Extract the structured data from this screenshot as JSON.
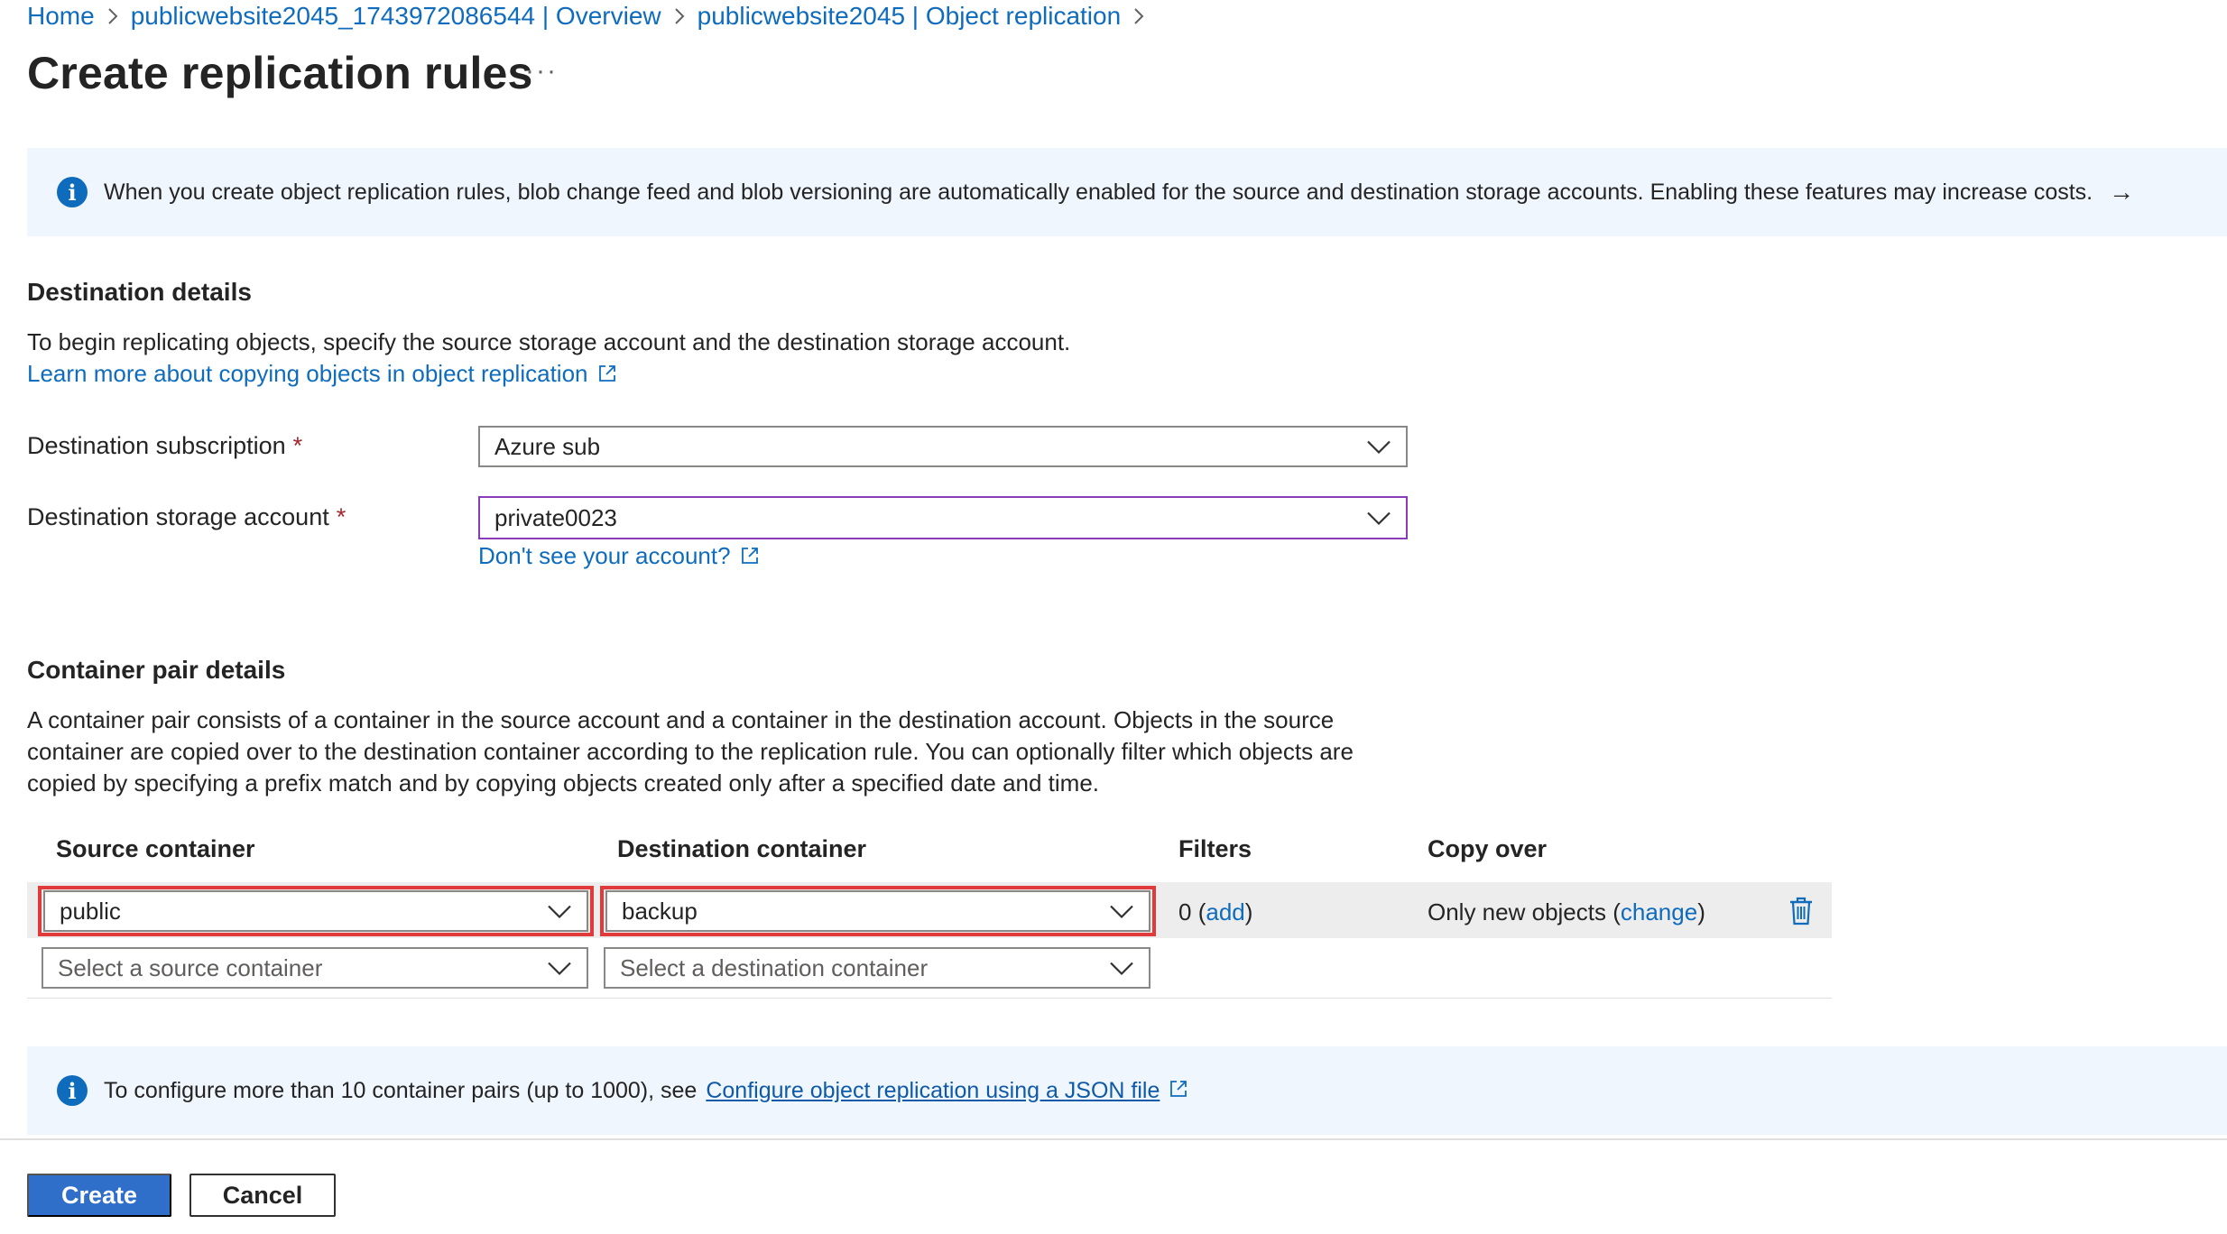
{
  "breadcrumb": {
    "items": [
      {
        "label": "Home"
      },
      {
        "label": "publicwebsite2045_1743972086544 | Overview"
      },
      {
        "label": "publicwebsite2045 | Object replication"
      }
    ]
  },
  "page": {
    "title": "Create replication rules",
    "more_label": "···"
  },
  "banner_top": {
    "icon": "info-icon",
    "text": "When you create object replication rules, blob change feed and blob versioning are automatically enabled for the source and destination storage accounts. Enabling these features may increase costs.",
    "arrow": "→"
  },
  "destination": {
    "heading": "Destination details",
    "description": "To begin replicating objects, specify the source storage account and the destination storage account.",
    "learn_more": "Learn more about copying objects in object replication",
    "subscription_label": "Destination subscription",
    "subscription_value": "Azure sub",
    "storage_label": "Destination storage account",
    "storage_value": "private0023",
    "required_mark": "*",
    "dont_see_link": "Don't see your account?"
  },
  "container_pairs": {
    "heading": "Container pair details",
    "description_lines": [
      "A container pair consists of a container in the source account and a container in the destination account. Objects in the source",
      "container are copied over to the destination container according to the replication rule. You can optionally filter which objects are",
      "copied by specifying a prefix match and by copying objects created only after a specified date and time."
    ],
    "columns": {
      "source": "Source container",
      "destination": "Destination container",
      "filters": "Filters",
      "copy_over": "Copy over"
    },
    "row": {
      "source": "public",
      "destination": "backup",
      "filters_count": "0",
      "filters_add": "add",
      "copy_over_text": "Only new objects",
      "copy_over_change": "change"
    },
    "new_row": {
      "source_placeholder": "Select a source container",
      "destination_placeholder": "Select a destination container"
    }
  },
  "banner_bottom": {
    "icon": "info-icon",
    "text": "To configure more than 10 container pairs (up to 1000), see",
    "link": "Configure object replication using a JSON file"
  },
  "footer": {
    "create_label": "Create",
    "cancel_label": "Cancel"
  },
  "colors": {
    "accent": "#0f6cbd",
    "primary_button": "#2f6fc9",
    "highlight_frame": "#e03a3a",
    "banner_bg": "#f0f6fd"
  }
}
